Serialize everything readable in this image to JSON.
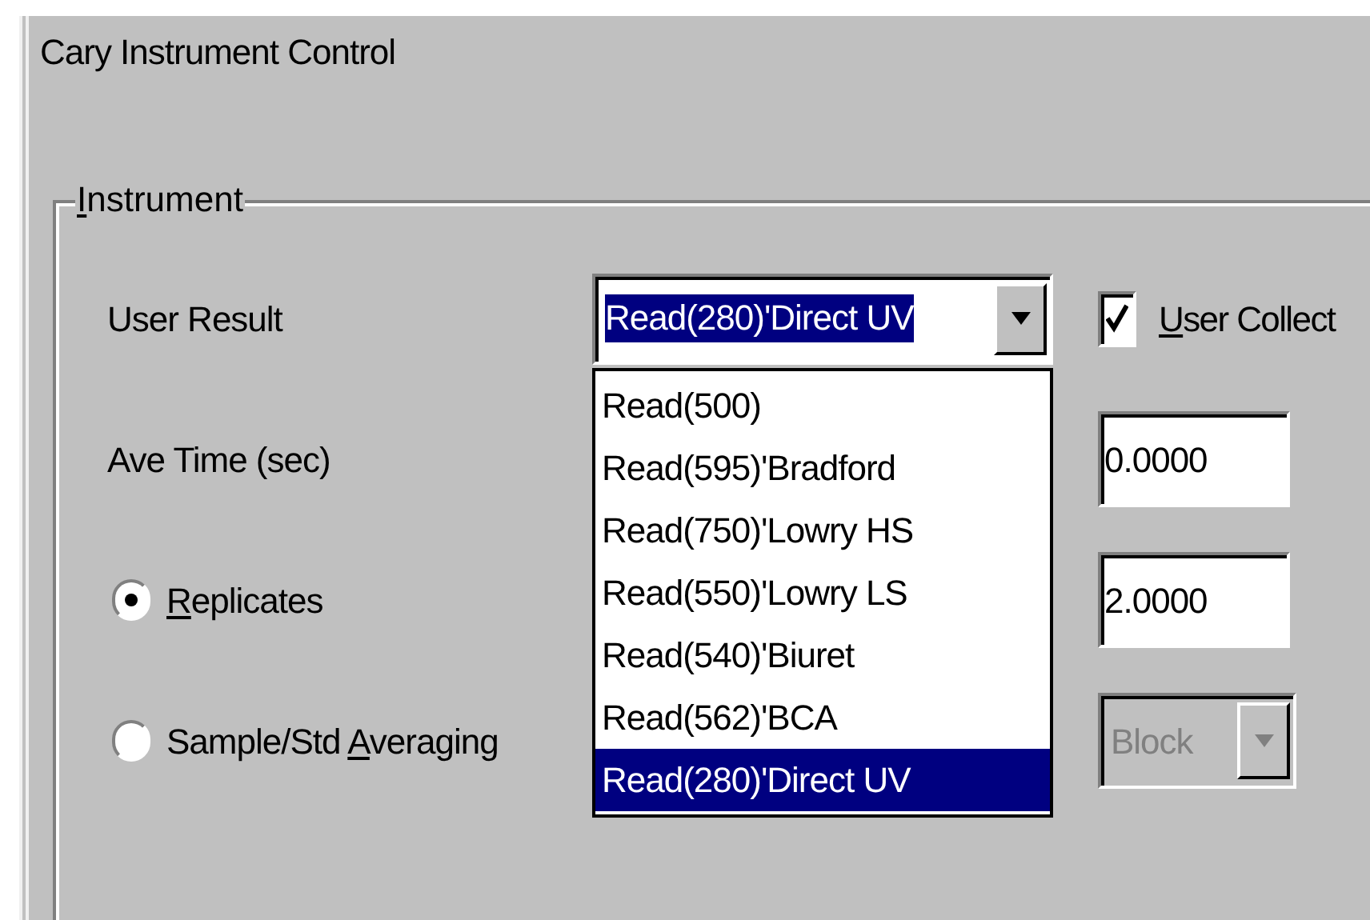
{
  "window": {
    "title": "Cary Instrument Control"
  },
  "group": {
    "label": {
      "key": "I",
      "post": "nstrument"
    }
  },
  "user_result": {
    "label": "User Result",
    "value": "Read(280)'Direct UV",
    "expanded": true,
    "options": [
      {
        "label": "Read(500)",
        "selected": false
      },
      {
        "label": "Read(595)'Bradford",
        "selected": false
      },
      {
        "label": "Read(750)'Lowry HS",
        "selected": false
      },
      {
        "label": "Read(550)'Lowry LS",
        "selected": false
      },
      {
        "label": "Read(540)'Biuret",
        "selected": false
      },
      {
        "label": "Read(562)'BCA",
        "selected": false
      },
      {
        "label": "Read(280)'Direct UV",
        "selected": true
      }
    ]
  },
  "user_collect": {
    "label": {
      "key": "U",
      "post": "ser Collect"
    },
    "checked": true
  },
  "ave_time": {
    "label": "Ave Time (sec)",
    "value": "0.0000"
  },
  "modes": [
    {
      "label": {
        "key": "R",
        "post": "eplicates"
      },
      "selected": true,
      "field": {
        "kind": "text",
        "value": "2.0000"
      }
    },
    {
      "label": {
        "pre": "Sample/Std ",
        "key": "A",
        "post": "veraging"
      },
      "selected": false,
      "field": {
        "kind": "select",
        "value": "Block",
        "disabled": true
      }
    }
  ]
}
